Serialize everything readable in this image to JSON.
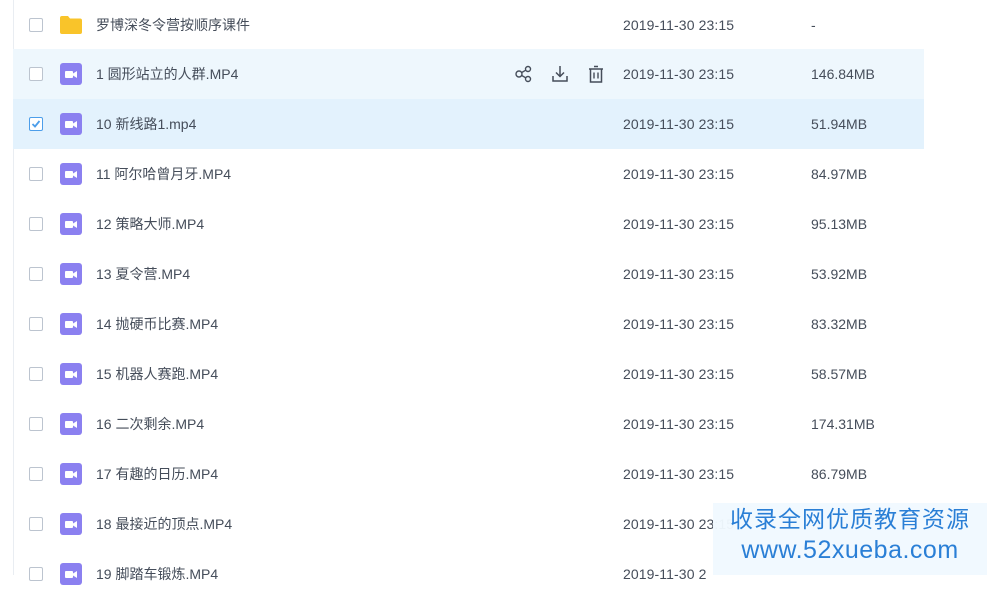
{
  "files": [
    {
      "name": "罗博深冬令营按顺序课件",
      "type": "folder",
      "date": "2019-11-30 23:15",
      "size": "-",
      "checked": false,
      "state": ""
    },
    {
      "name": "1 圆形站立的人群.MP4",
      "type": "video",
      "date": "2019-11-30 23:15",
      "size": "146.84MB",
      "checked": false,
      "state": "hover"
    },
    {
      "name": "10 新线路1.mp4",
      "type": "video",
      "date": "2019-11-30 23:15",
      "size": "51.94MB",
      "checked": true,
      "state": "selected"
    },
    {
      "name": "11 阿尔哈曾月牙.MP4",
      "type": "video",
      "date": "2019-11-30 23:15",
      "size": "84.97MB",
      "checked": false,
      "state": ""
    },
    {
      "name": "12 策略大师.MP4",
      "type": "video",
      "date": "2019-11-30 23:15",
      "size": "95.13MB",
      "checked": false,
      "state": ""
    },
    {
      "name": "13 夏令营.MP4",
      "type": "video",
      "date": "2019-11-30 23:15",
      "size": "53.92MB",
      "checked": false,
      "state": ""
    },
    {
      "name": "14 抛硬币比赛.MP4",
      "type": "video",
      "date": "2019-11-30 23:15",
      "size": "83.32MB",
      "checked": false,
      "state": ""
    },
    {
      "name": "15 机器人赛跑.MP4",
      "type": "video",
      "date": "2019-11-30 23:15",
      "size": "58.57MB",
      "checked": false,
      "state": ""
    },
    {
      "name": "16 二次剩余.MP4",
      "type": "video",
      "date": "2019-11-30 23:15",
      "size": "174.31MB",
      "checked": false,
      "state": ""
    },
    {
      "name": "17 有趣的日历.MP4",
      "type": "video",
      "date": "2019-11-30 23:15",
      "size": "86.79MB",
      "checked": false,
      "state": ""
    },
    {
      "name": "18 最接近的顶点.MP4",
      "type": "video",
      "date": "2019-11-30 23:15",
      "size": "",
      "checked": false,
      "state": ""
    },
    {
      "name": "19 脚踏车锻炼.MP4",
      "type": "video",
      "date": "2019-11-30 2",
      "size": "",
      "checked": false,
      "state": ""
    }
  ],
  "row_actions": [
    "share-icon",
    "download-icon",
    "delete-icon"
  ],
  "watermark": {
    "line1": "收录全网优质教育资源",
    "line2": "www.52xueba.com"
  },
  "colors": {
    "folder": "#f9c42a",
    "video": "#8b80f0",
    "hover_row": "#eef7fd",
    "selected_row": "#e3f2fd",
    "checkbox_checked": "#4c9eea",
    "watermark_text": "#2a7fd6"
  }
}
